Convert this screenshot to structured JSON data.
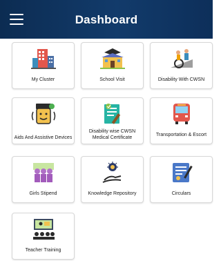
{
  "appbar": {
    "title": "Dashboard",
    "menu_icon": "hamburger-menu-icon"
  },
  "tiles": [
    {
      "label": "My Cluster",
      "icon": "buildings-icon"
    },
    {
      "label": "School Visit",
      "icon": "school-building-icon"
    },
    {
      "label": "Disability With CWSN",
      "icon": "wheelchair-ramp-icon"
    },
    {
      "label": "Aids And Assistive Devices",
      "icon": "assistive-device-icon"
    },
    {
      "label": "Disability wise CWSN Medical Certificate",
      "icon": "medical-certificate-icon"
    },
    {
      "label": "Transportation & Escort",
      "icon": "bus-icon"
    },
    {
      "label": "Girls Stipend",
      "icon": "girls-group-icon"
    },
    {
      "label": "Knowledge Repository",
      "icon": "idea-hand-icon"
    },
    {
      "label": "Circulars",
      "icon": "circular-document-icon"
    },
    {
      "label": "Teacher Training",
      "icon": "teacher-training-icon"
    }
  ]
}
